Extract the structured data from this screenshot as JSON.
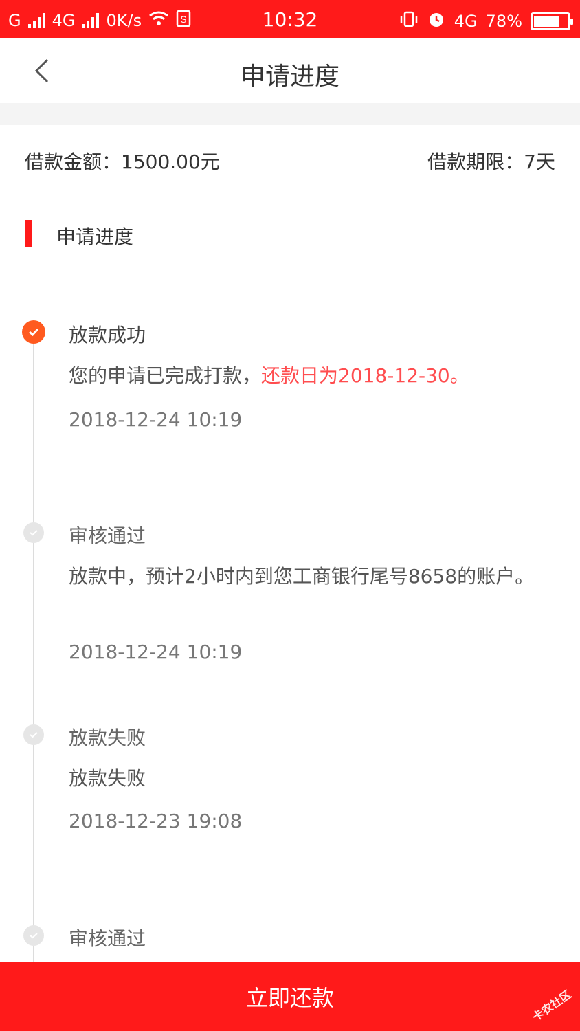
{
  "status_bar": {
    "carrier_left": "G",
    "network_1": "4G",
    "speed": "0K/s",
    "time": "10:32",
    "network_2": "4G",
    "battery": "78%",
    "battery_level": 0.78
  },
  "header": {
    "title": "申请进度"
  },
  "summary": {
    "amount": "借款金额：1500.00元",
    "term": "借款期限：7天"
  },
  "section": {
    "title": "申请进度"
  },
  "timeline": [
    {
      "title": "放款成功",
      "desc": "您的申请已完成打款，",
      "desc_highlight": "还款日为2018-12-30。",
      "time": "2018-12-24 10:19",
      "status": "active"
    },
    {
      "title": "审核通过",
      "desc": "放款中，预计2小时内到您工商银行尾号8658的账户。",
      "desc_highlight": "",
      "time": "2018-12-24 10:19",
      "status": "inactive"
    },
    {
      "title": "放款失败",
      "desc": "放款失败",
      "desc_highlight": "",
      "time": "2018-12-23 19:08",
      "status": "inactive"
    },
    {
      "title": "审核通过",
      "desc": "",
      "desc_highlight": "",
      "time": "",
      "status": "inactive"
    }
  ],
  "footer": {
    "button_label": "立即还款"
  },
  "watermark": "卡农社区",
  "colors": {
    "brand": "#ff1a1a",
    "active_dot": "#ff5a1f",
    "highlight": "#ff4d4f"
  }
}
